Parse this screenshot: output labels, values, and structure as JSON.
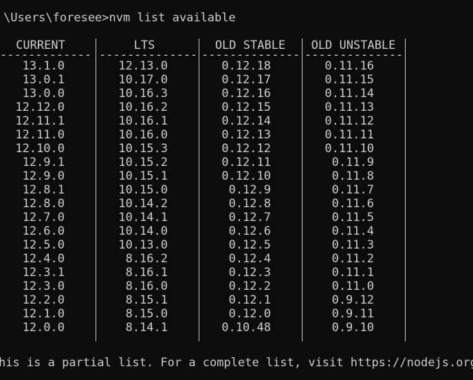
{
  "terminal": {
    "prompt": "\\Users\\foresee>nvm list available",
    "footer": "his is a partial list. For a complete list, visit https://nodejs.org/d"
  },
  "table": {
    "dash": "--------------",
    "columns": [
      {
        "header": "CURRENT",
        "values": [
          "13.1.0",
          "13.0.1",
          "13.0.0",
          "12.12.0",
          "12.11.1",
          "12.11.0",
          "12.10.0",
          "12.9.1",
          "12.9.0",
          "12.8.1",
          "12.8.0",
          "12.7.0",
          "12.6.0",
          "12.5.0",
          "12.4.0",
          "12.3.1",
          "12.3.0",
          "12.2.0",
          "12.1.0",
          "12.0.0"
        ]
      },
      {
        "header": "LTS",
        "values": [
          "12.13.0",
          "10.17.0",
          "10.16.3",
          "10.16.2",
          "10.16.1",
          "10.16.0",
          "10.15.3",
          "10.15.2",
          "10.15.1",
          "10.15.0",
          "10.14.2",
          "10.14.1",
          "10.14.0",
          "10.13.0",
          "8.16.2",
          "8.16.1",
          "8.16.0",
          "8.15.1",
          "8.15.0",
          "8.14.1"
        ]
      },
      {
        "header": "OLD STABLE",
        "values": [
          "0.12.18",
          "0.12.17",
          "0.12.16",
          "0.12.15",
          "0.12.14",
          "0.12.13",
          "0.12.12",
          "0.12.11",
          "0.12.10",
          "0.12.9",
          "0.12.8",
          "0.12.7",
          "0.12.6",
          "0.12.5",
          "0.12.4",
          "0.12.3",
          "0.12.2",
          "0.12.1",
          "0.12.0",
          "0.10.48"
        ]
      },
      {
        "header": "OLD UNSTABLE",
        "values": [
          "0.11.16",
          "0.11.15",
          "0.11.14",
          "0.11.13",
          "0.11.12",
          "0.11.11",
          "0.11.10",
          "0.11.9",
          "0.11.8",
          "0.11.7",
          "0.11.6",
          "0.11.5",
          "0.11.4",
          "0.11.3",
          "0.11.2",
          "0.11.1",
          "0.11.0",
          "0.9.12",
          "0.9.11",
          "0.9.10"
        ]
      }
    ]
  }
}
